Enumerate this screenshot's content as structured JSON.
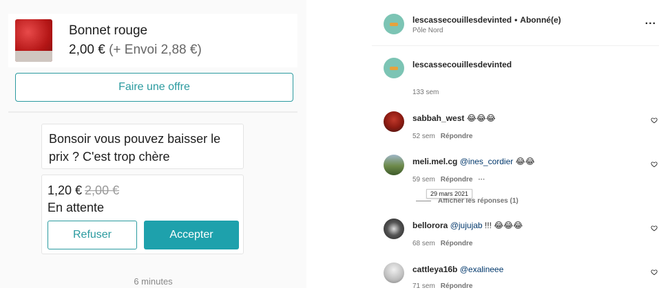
{
  "vinted": {
    "item_title": "Bonnet rouge",
    "item_price": "2,00 €",
    "item_shipping": "(+ Envoi 2,88 €)",
    "offer_button": "Faire une offre",
    "message": "Bonsoir vous pouvez baisser le prix ? C'est trop chère",
    "offer_price": "1,20 €",
    "offer_old_price": "2,00 €",
    "offer_status": "En attente",
    "refuse_button": "Refuser",
    "accept_button": "Accepter",
    "message_time": "6 minutes"
  },
  "instagram": {
    "header": {
      "username": "lescassecouillesdevinted",
      "dot": "•",
      "follow_status": "Abonné(e)",
      "location": "Pôle Nord",
      "more": "..."
    },
    "caption": {
      "username": "lescassecouillesdevinted",
      "time": "133 sem"
    },
    "comments": [
      {
        "username": "sabbah_west",
        "text": "😂😂😂",
        "mention": "",
        "time": "52 sem",
        "reply": "Répondre"
      },
      {
        "username": "meli.mel.cg",
        "mention": "@ines_cordier",
        "text": "😂😂",
        "time": "59 sem",
        "reply": "Répondre",
        "more": "···"
      },
      {
        "username": "bellorora",
        "mention": "@jujujab",
        "text": "!!! 😂😂😂",
        "time": "68 sem",
        "reply": "Répondre"
      },
      {
        "username": "cattleya16b",
        "mention": "@exalineee",
        "text": "",
        "time": "71 sem",
        "reply": "Répondre"
      }
    ],
    "tooltip": "29 mars 2021",
    "view_replies": "Afficher les réponses (1)"
  },
  "colors": {
    "vinted_teal": "#1ea1ac",
    "ig_link": "#00376b",
    "ig_meta": "#737373"
  },
  "icons": [
    "more-icon",
    "heart-icon"
  ]
}
